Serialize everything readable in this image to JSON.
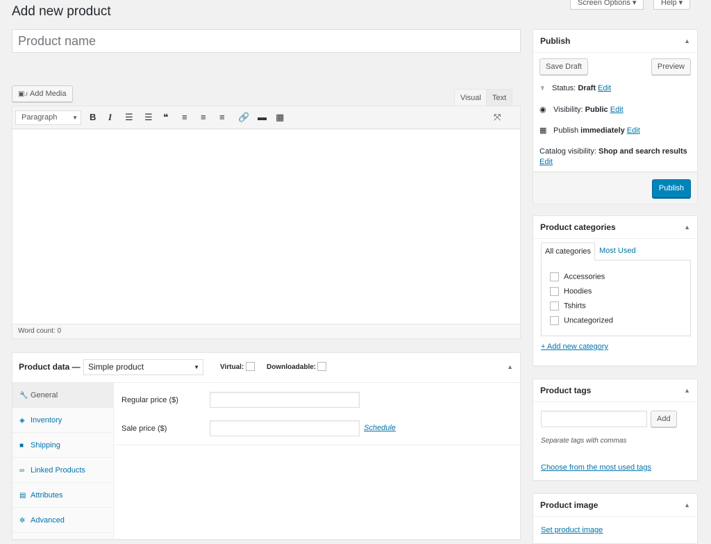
{
  "header": {
    "title": "Add new product",
    "screen_options": "Screen Options ▾",
    "help": "Help ▾"
  },
  "title_field": {
    "placeholder": "Product name"
  },
  "editor": {
    "add_media": "Add Media",
    "tab_visual": "Visual",
    "tab_text": "Text",
    "format_select": "Paragraph",
    "word_count": "Word count: 0"
  },
  "product_data": {
    "label": "Product data —",
    "type_select": "Simple product",
    "virtual_label": "Virtual:",
    "downloadable_label": "Downloadable:",
    "tabs": [
      {
        "label": "General",
        "icon": "wrench-icon"
      },
      {
        "label": "Inventory",
        "icon": "tag-icon"
      },
      {
        "label": "Shipping",
        "icon": "truck-icon"
      },
      {
        "label": "Linked Products",
        "icon": "link-icon"
      },
      {
        "label": "Attributes",
        "icon": "list-icon"
      },
      {
        "label": "Advanced",
        "icon": "gear-icon"
      }
    ],
    "regular_price_label": "Regular price ($)",
    "sale_price_label": "Sale price ($)",
    "schedule_link": "Schedule"
  },
  "publish": {
    "title": "Publish",
    "save_draft": "Save Draft",
    "preview": "Preview",
    "status_label": "Status:",
    "status_value": "Draft",
    "visibility_label": "Visibility:",
    "visibility_value": "Public",
    "publish_label": "Publish",
    "publish_value": "immediately",
    "catalog_label": "Catalog visibility:",
    "catalog_value": "Shop and search results",
    "edit": "Edit",
    "publish_button": "Publish"
  },
  "categories": {
    "title": "Product categories",
    "tab_all": "All categories",
    "tab_most_used": "Most Used",
    "items": [
      "Accessories",
      "Hoodies",
      "Tshirts",
      "Uncategorized"
    ],
    "add_new": "+ Add new category"
  },
  "tags": {
    "title": "Product tags",
    "add_button": "Add",
    "hint": "Separate tags with commas",
    "choose_link": "Choose from the most used tags"
  },
  "image": {
    "title": "Product image",
    "set_link": "Set product image"
  },
  "colors": {
    "accent": "#0073aa",
    "primary_button": "#0085ba"
  }
}
